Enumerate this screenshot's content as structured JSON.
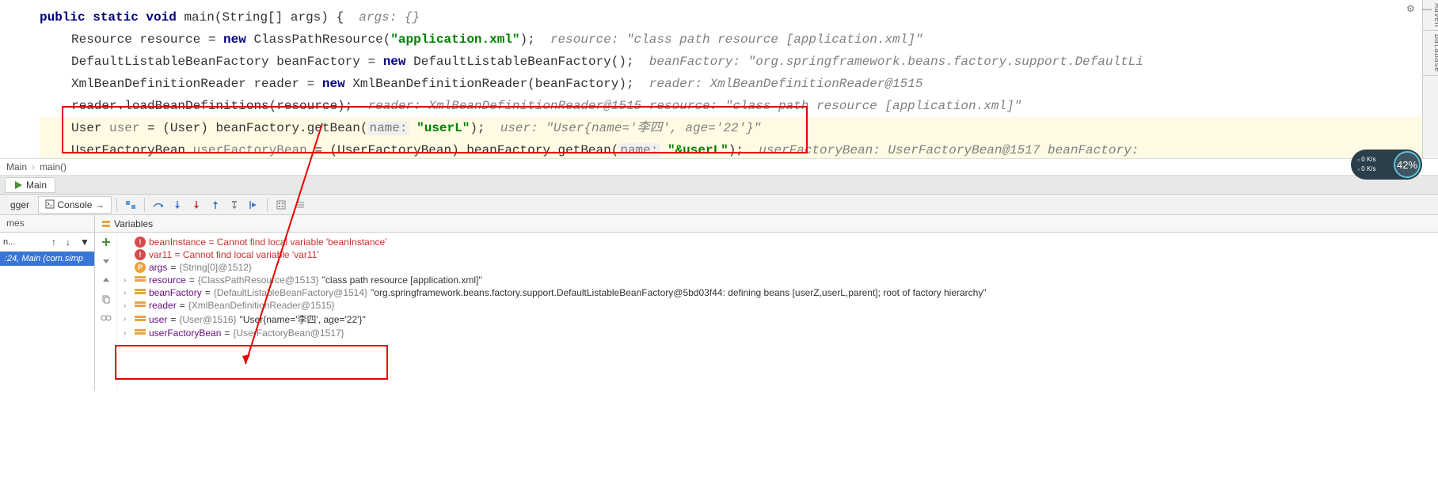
{
  "code": {
    "line1_kw1": "public static void",
    "line1_fn": "main",
    "line1_sig": "(String[] args) {",
    "line1_hint": "args: {}",
    "line2_cls1": "Resource",
    "line2_var": "resource",
    "line2_eq": " = ",
    "line2_kw": "new",
    "line2_cls2": "ClassPathResource(",
    "line2_str": "\"application.xml\"",
    "line2_end": ");",
    "line2_hint": "resource: \"class path resource [application.xml]\"",
    "line3_cls1": "DefaultListableBeanFactory",
    "line3_var": "beanFactory",
    "line3_eq": " = ",
    "line3_kw": "new",
    "line3_cls2": "DefaultListableBeanFactory();",
    "line3_hint": "beanFactory: \"org.springframework.beans.factory.support.DefaultLi",
    "line4_cls1": "XmlBeanDefinitionReader",
    "line4_var": "reader",
    "line4_eq": " = ",
    "line4_kw": "new",
    "line4_cls2": "XmlBeanDefinitionReader(beanFactory);",
    "line4_hint": "reader: XmlBeanDefinitionReader@1515",
    "line5_text": "reader.loadBeanDefinitions(resource);",
    "line5_hint": "reader: XmlBeanDefinitionReader@1515   resource: \"class path resource [application.xml]\"",
    "line6_cls": "User",
    "line6_var": "user",
    "line6_cast": " = (User) beanFactory.getBean(",
    "line6_param": "name:",
    "line6_str": "\"userL\"",
    "line6_end": ");",
    "line6_hint": "user: \"User{name='李四', age='22'}\"",
    "line7_cls": "UserFactoryBean",
    "line7_var": "userFactoryBean",
    "line7_cast": " = (UserFactoryBean) beanFactory.getBean(",
    "line7_param": "name:",
    "line7_str": "\"&userL\"",
    "line7_end": ");",
    "line7_hint": "userFactoryBean: UserFactoryBean@1517   beanFactory:"
  },
  "side": {
    "maven": "Maven",
    "db": "Database"
  },
  "crumb": {
    "a": "Main",
    "b": "main()"
  },
  "gauge": {
    "rate1": "0 K/s",
    "rate2": "0 K/s",
    "pct": "42%"
  },
  "tab": {
    "name": "Main"
  },
  "toolbar": {
    "dbg": "gger",
    "console": "Console"
  },
  "panels": {
    "frames": "mes",
    "vars": "Variables"
  },
  "frame": {
    "main_lbl": "n...",
    "line": ":24, Main (com.simp"
  },
  "vars": {
    "err1_name": "beanInstance",
    "err1_val": "Cannot find local variable 'beanInstance'",
    "err2_name": "var11",
    "err2_val": "Cannot find local variable 'var11'",
    "args_name": "args",
    "args_val": "{String[0]@1512}",
    "res_name": "resource",
    "res_type": "{ClassPathResource@1513}",
    "res_val": "\"class path resource [application.xml]\"",
    "bf_name": "beanFactory",
    "bf_type": "{DefaultListableBeanFactory@1514}",
    "bf_val": "\"org.springframework.beans.factory.support.DefaultListableBeanFactory@5bd03f44: defining beans [userZ,userL,parent]; root of factory hierarchy\"",
    "rd_name": "reader",
    "rd_type": "{XmlBeanDefinitionReader@1515}",
    "u_name": "user",
    "u_type": "{User@1516}",
    "u_val": "\"User{name='李四', age='22'}\"",
    "ufb_name": "userFactoryBean",
    "ufb_type": "{UserFactoryBean@1517}"
  }
}
